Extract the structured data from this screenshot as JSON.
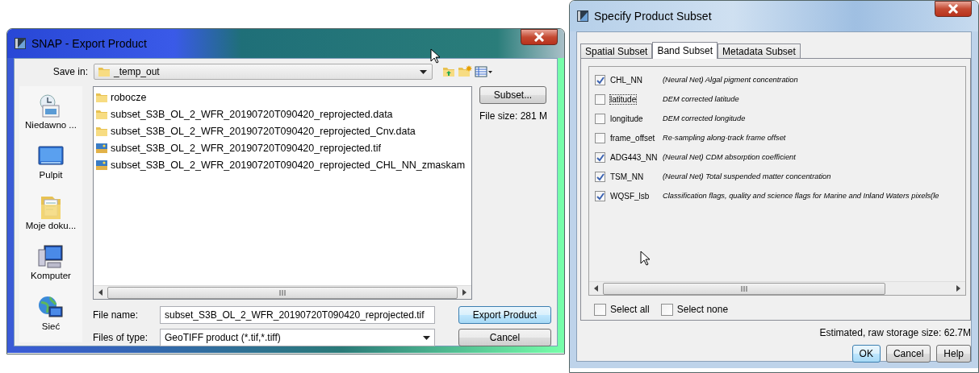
{
  "export_dialog": {
    "title": "SNAP - Export Product",
    "save_in_label": "Save in:",
    "save_in_value": "_temp_out",
    "places": [
      {
        "label": "Niedawno ...",
        "kind": "recent"
      },
      {
        "label": "Pulpit",
        "kind": "desktop"
      },
      {
        "label": "Moje doku...",
        "kind": "documents"
      },
      {
        "label": "Komputer",
        "kind": "computer"
      },
      {
        "label": "Sieć",
        "kind": "network"
      }
    ],
    "files": [
      {
        "name": "robocze",
        "kind": "folder"
      },
      {
        "name": "subset_S3B_OL_2_WFR_20190720T090420_reprojected.data",
        "kind": "folder"
      },
      {
        "name": "subset_S3B_OL_2_WFR_20190720T090420_reprojected_Cnv.data",
        "kind": "folder"
      },
      {
        "name": "subset_S3B_OL_2_WFR_20190720T090420_reprojected.tif",
        "kind": "image"
      },
      {
        "name": "subset_S3B_OL_2_WFR_20190720T090420_reprojected_CHL_NN_zmaskam",
        "kind": "image"
      }
    ],
    "subset_button": "Subset...",
    "file_size": "File size: 281 M",
    "file_name_label": "File name:",
    "file_name_value": "subset_S3B_OL_2_WFR_20190720T090420_reprojected.tif",
    "files_of_type_label": "Files of type:",
    "files_of_type_value": "GeoTIFF product (*.tif,*.tiff)",
    "buttons": [
      "Export Product",
      "Cancel"
    ]
  },
  "subset_dialog": {
    "title": "Specify Product Subset",
    "tabs": [
      {
        "label": "Spatial Subset",
        "selected": false
      },
      {
        "label": "Band Subset",
        "selected": true
      },
      {
        "label": "Metadata Subset",
        "selected": false
      }
    ],
    "bands": [
      {
        "name": "CHL_NN",
        "description": "(Neural Net) Algal pigment concentration",
        "checked": true,
        "focused": false
      },
      {
        "name": "latitude",
        "description": "DEM corrected latitude",
        "checked": false,
        "focused": true
      },
      {
        "name": "longitude",
        "description": "DEM corrected longitude",
        "checked": false,
        "focused": false
      },
      {
        "name": "frame_offset",
        "description": "Re-sampling along-track frame offset",
        "checked": false,
        "focused": false
      },
      {
        "name": "ADG443_NN",
        "description": "(Neural Net) CDM absorption coefficient",
        "checked": true,
        "focused": false
      },
      {
        "name": "TSM_NN",
        "description": "(Neural Net) Total suspended matter concentration",
        "checked": true,
        "focused": false
      },
      {
        "name": "WQSF_lsb",
        "description": "Classification flags, quality and science flags for Marine and Inland Waters pixels(le",
        "checked": true,
        "focused": false
      }
    ],
    "select_all": {
      "label": "Select all",
      "checked": false
    },
    "select_none": {
      "label": "Select none",
      "checked": false
    },
    "storage_size": "Estimated, raw storage size: 62.7M",
    "buttons": [
      "OK",
      "Cancel",
      "Help"
    ]
  }
}
